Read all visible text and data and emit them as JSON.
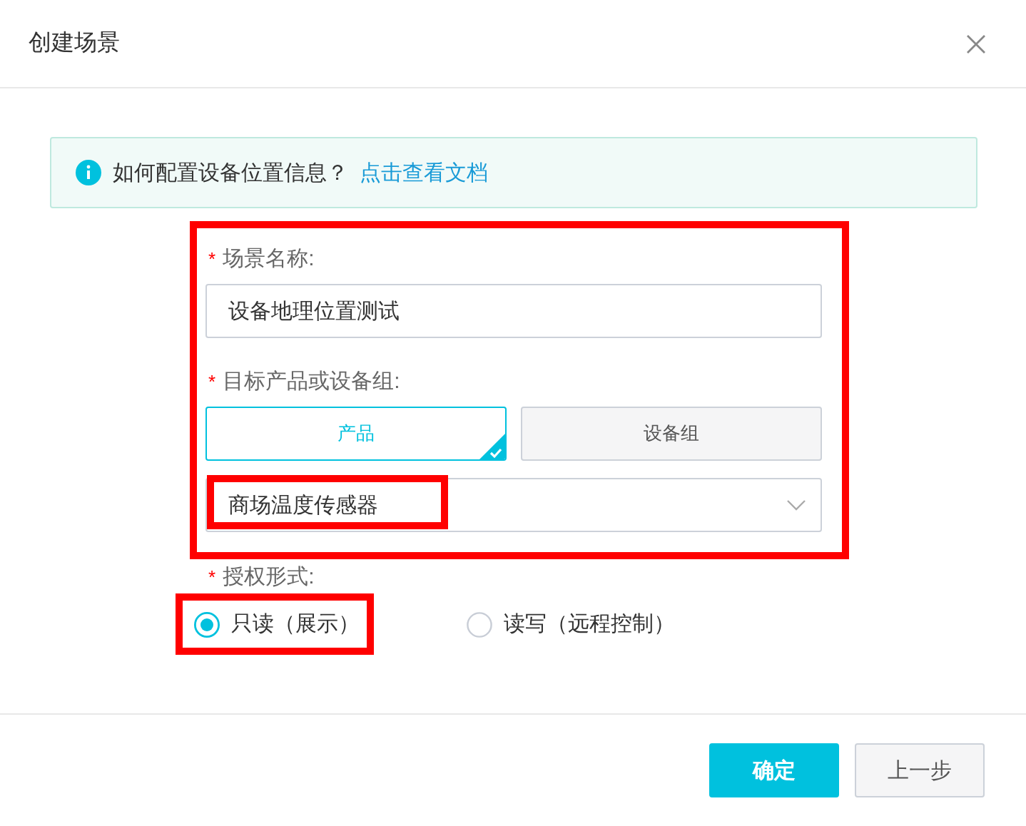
{
  "dialog": {
    "title": "创建场景"
  },
  "alert": {
    "text": "如何配置设备位置信息？",
    "link": "点击查看文档"
  },
  "sections": [
    {
      "highlighted": true,
      "fields": [
        {
          "kind": "text",
          "required_mark": "*",
          "label": "场景名称:",
          "value": "设备地理位置测试"
        },
        {
          "kind": "segmented",
          "required_mark": "*",
          "label": "目标产品或设备组:",
          "options": [
            {
              "label": "产品",
              "selected": true
            },
            {
              "label": "设备组",
              "selected": false
            }
          ]
        },
        {
          "kind": "select",
          "value": "商场温度传感器",
          "highlighted": true
        }
      ]
    },
    {
      "fields": [
        {
          "kind": "radio",
          "required_mark": "*",
          "label": "授权形式:",
          "options": [
            {
              "label": "只读（展示）",
              "selected": true,
              "highlighted": true
            },
            {
              "label": "读写（远程控制）",
              "selected": false,
              "highlighted": false
            }
          ]
        }
      ]
    }
  ],
  "buttons": [
    {
      "label": "确定",
      "kind": "primary"
    },
    {
      "label": "上一步",
      "kind": "default"
    }
  ]
}
